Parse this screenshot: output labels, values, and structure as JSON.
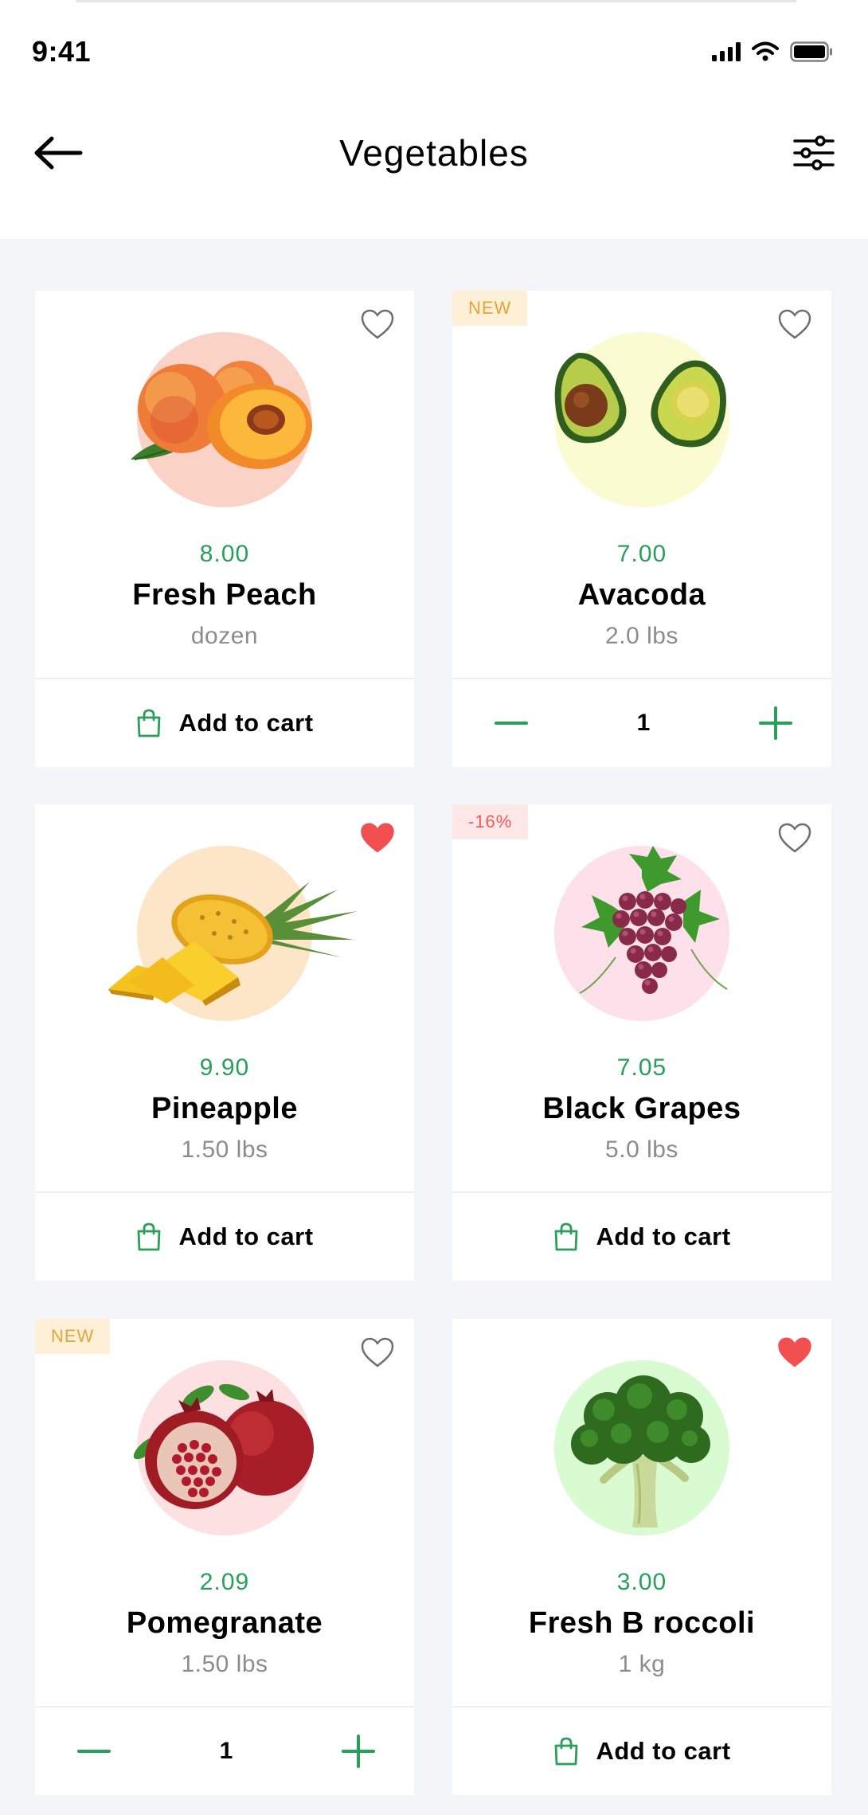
{
  "status": {
    "time": "9:41"
  },
  "header": {
    "title": "Vegetables"
  },
  "colors": {
    "accent": "#28a05a",
    "favorite": "#f25050",
    "background": "#f4f5f9"
  },
  "products": [
    {
      "price": "8.00",
      "name": "Fresh Peach",
      "unit": "dozen",
      "badge": "",
      "favorite": false,
      "action": "Add to cart",
      "blob_color": "#fbd3c6",
      "image_icon": "peach-icon"
    },
    {
      "price": "7.00",
      "name": "Avacoda",
      "unit": "2.0 lbs",
      "badge": "NEW",
      "favorite": false,
      "quantity": "1",
      "blob_color": "#fbfbd2",
      "image_icon": "avocado-icon"
    },
    {
      "price": "9.90",
      "name": "Pineapple",
      "unit": "1.50 lbs",
      "badge": "",
      "favorite": true,
      "action": "Add to cart",
      "blob_color": "#fde6c8",
      "image_icon": "pineapple-icon"
    },
    {
      "price": "7.05",
      "name": "Black Grapes",
      "unit": "5.0 lbs",
      "badge": "-16%",
      "favorite": false,
      "action": "Add to cart",
      "blob_color": "#fde0ea",
      "image_icon": "grapes-icon"
    },
    {
      "price": "2.09",
      "name": "Pomegranate",
      "unit": "1.50 lbs",
      "badge": "NEW",
      "favorite": false,
      "quantity": "1",
      "blob_color": "#fde0e2",
      "image_icon": "pomegranate-icon"
    },
    {
      "price": "3.00",
      "name": "Fresh B roccoli",
      "unit": "1 kg",
      "badge": "",
      "favorite": true,
      "action": "Add to cart",
      "blob_color": "#d8fbd2",
      "image_icon": "broccoli-icon"
    }
  ]
}
